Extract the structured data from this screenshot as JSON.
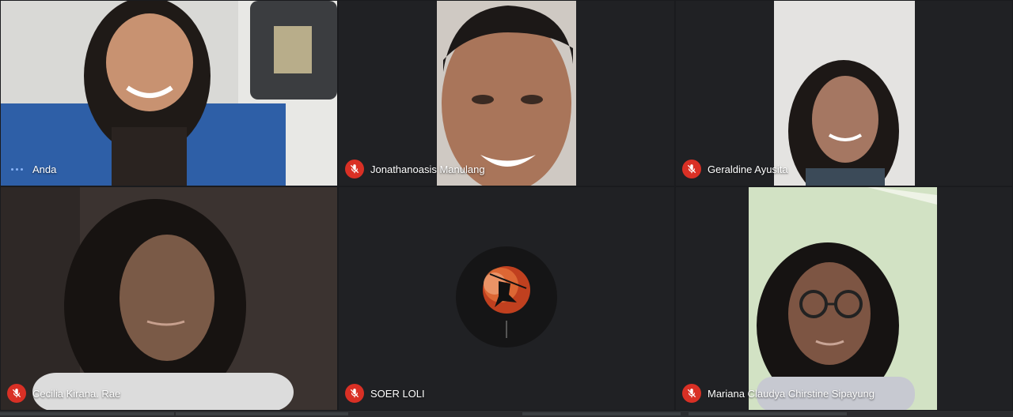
{
  "participants": [
    {
      "name": "Anda",
      "muted": false
    },
    {
      "name": "Jonathanoasis Manulang",
      "muted": true
    },
    {
      "name": "Geraldine Ayusita",
      "muted": true
    },
    {
      "name": "Cecilia Kirana. Rae",
      "muted": true
    },
    {
      "name": "SOER LOLI",
      "muted": true,
      "avatar": "moon-avatar"
    },
    {
      "name": "Mariana Claudya Chirstine Sipayung",
      "muted": true
    }
  ],
  "colors": {
    "background": "#202124",
    "mic_off_badge": "#d93025",
    "speaking_indicator": "#8ab4f8"
  },
  "icons": {
    "muted": "mic-off-icon",
    "speaking": "audio-activity-icon",
    "avatar": "moon-avatar"
  }
}
